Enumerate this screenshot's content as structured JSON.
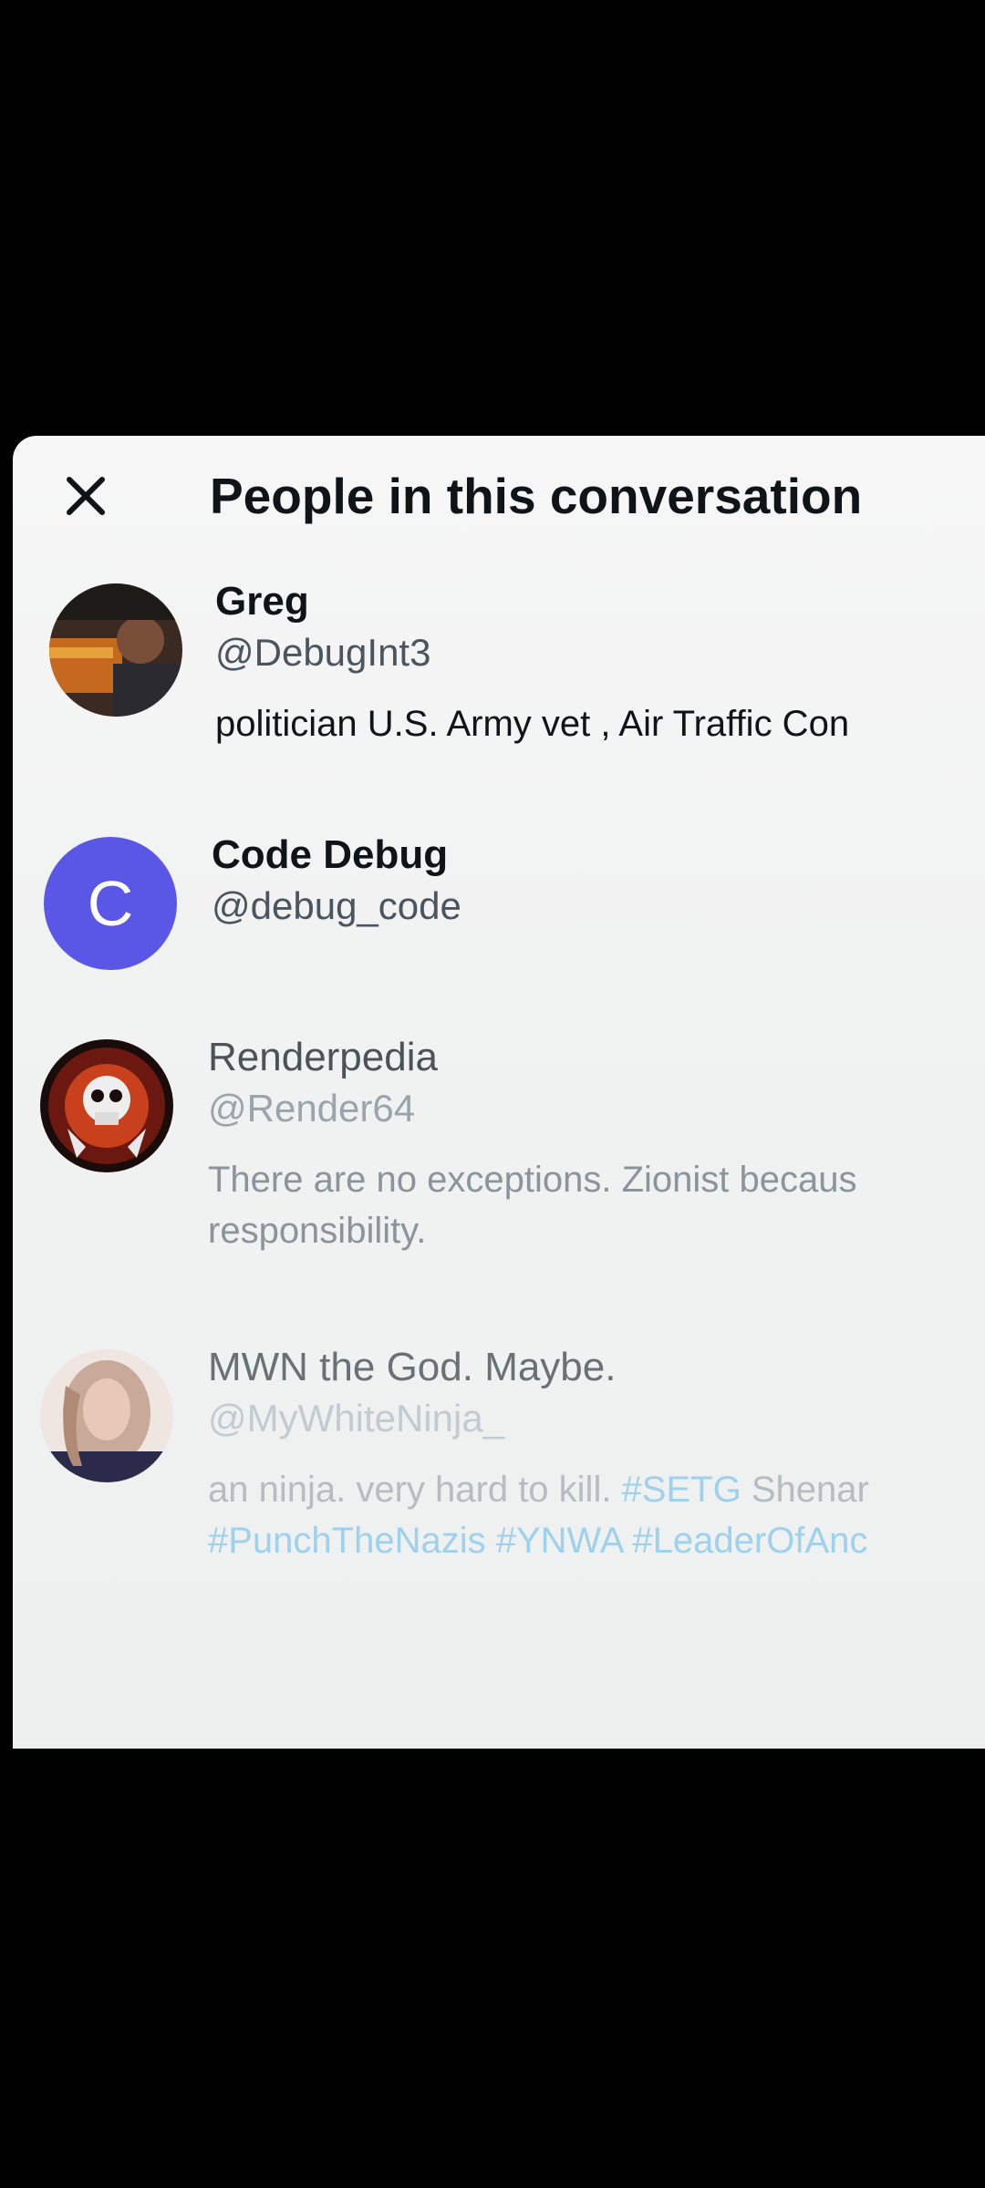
{
  "header": {
    "title": "People in this conversation",
    "close_icon": "close-icon"
  },
  "people": [
    {
      "name": "Greg",
      "handle": "@DebugInt3",
      "bio": "politician U.S. Army vet , Air Traffic Con",
      "avatar": "photo-avatar"
    },
    {
      "name": "Code Debug",
      "handle": "@debug_code",
      "avatar_letter": "C",
      "avatar_color": "#5b57e6"
    },
    {
      "name": "Renderpedia",
      "handle": "@Render64",
      "bio_line1": "There are no exceptions. Zionist becaus",
      "bio_line2": "responsibility.",
      "avatar": "skull-avatar"
    },
    {
      "name": "MWN the God. Maybe.",
      "handle": "@MyWhiteNinja_",
      "bio_line1_text": "an ninja. very hard to kill. ",
      "bio_line1_tag": "#SETG",
      "bio_line1_rest": " Shenar",
      "bio_line2_tags": [
        "#PunchTheNazis",
        "#YNWA",
        "#LeaderOfAnc"
      ],
      "avatar": "photo-avatar"
    }
  ],
  "colors": {
    "accent": "#1d9bf0",
    "avatar_purple": "#5b57e6",
    "text_primary": "#0f1419"
  }
}
